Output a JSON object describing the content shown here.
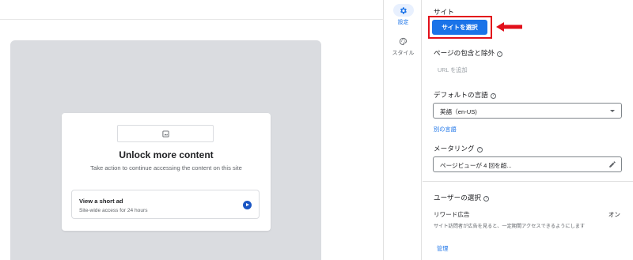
{
  "preview": {
    "card": {
      "title": "Unlock more content",
      "description": "Take action to continue accessing the content on this site",
      "option": {
        "title": "View a short ad",
        "subtitle": "Site-wide access for 24 hours"
      }
    }
  },
  "rail": {
    "items": [
      {
        "label": "設定",
        "icon": "gear-icon",
        "active": true
      },
      {
        "label": "スタイル",
        "icon": "palette-icon",
        "active": false
      }
    ]
  },
  "panel": {
    "site": {
      "label": "サイト",
      "button_label": "サイトを選択"
    },
    "include_exclude": {
      "label": "ページの包含と除外",
      "add_url": "URL を追加"
    },
    "language": {
      "label": "デフォルトの言語",
      "selected": "英語（en-US)",
      "other_link": "別の言語"
    },
    "metering": {
      "label": "メータリング",
      "value": "ページビューが 4 回を超..."
    },
    "user_choice": {
      "label": "ユーザーの選択",
      "reward_label": "リワード広告",
      "reward_status": "オン",
      "reward_desc": "サイト訪問者が広告を見ると、一定期間アクセスできるようにします",
      "manage_link": "管理"
    }
  },
  "colors": {
    "accent": "#1a73e8",
    "highlight": "#e2101b",
    "canvas": "#dadce0"
  }
}
